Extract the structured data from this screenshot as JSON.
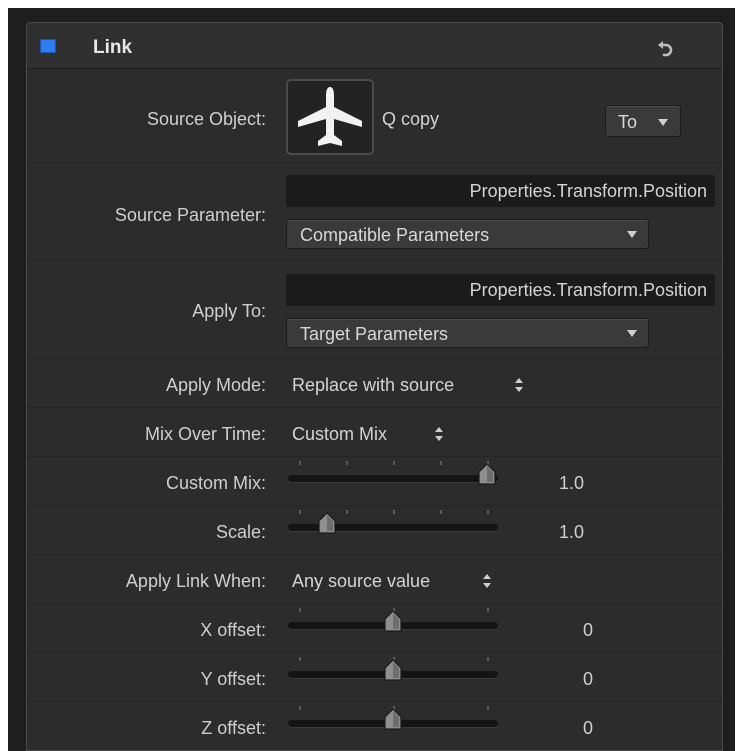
{
  "header": {
    "title": "Link"
  },
  "source_object": {
    "label": "Source Object:",
    "name": "Q copy",
    "icon": "airplane-icon",
    "to_popup": "To"
  },
  "source_parameter": {
    "label": "Source Parameter:",
    "value": "Properties.Transform.Position",
    "popup": "Compatible Parameters"
  },
  "apply_to": {
    "label": "Apply To:",
    "value": "Properties.Transform.Position",
    "popup": "Target Parameters"
  },
  "apply_mode": {
    "label": "Apply Mode:",
    "value": "Replace with source"
  },
  "mix_over_time": {
    "label": "Mix Over Time:",
    "value": "Custom Mix"
  },
  "custom_mix": {
    "label": "Custom Mix:",
    "value": "1.0",
    "level": 1.0
  },
  "scale": {
    "label": "Scale:",
    "value": "1.0",
    "level": 0.15
  },
  "apply_link_when": {
    "label": "Apply Link When:",
    "value": "Any source value"
  },
  "x_offset": {
    "label": "X offset:",
    "value": "0",
    "level": 0.5
  },
  "y_offset": {
    "label": "Y offset:",
    "value": "0",
    "level": 0.5
  },
  "z_offset": {
    "label": "Z offset:",
    "value": "0",
    "level": 0.5
  },
  "colors": {
    "accent": "#2f7bf0",
    "panel": "#2c2c2c",
    "field": "#1b1b1b"
  }
}
